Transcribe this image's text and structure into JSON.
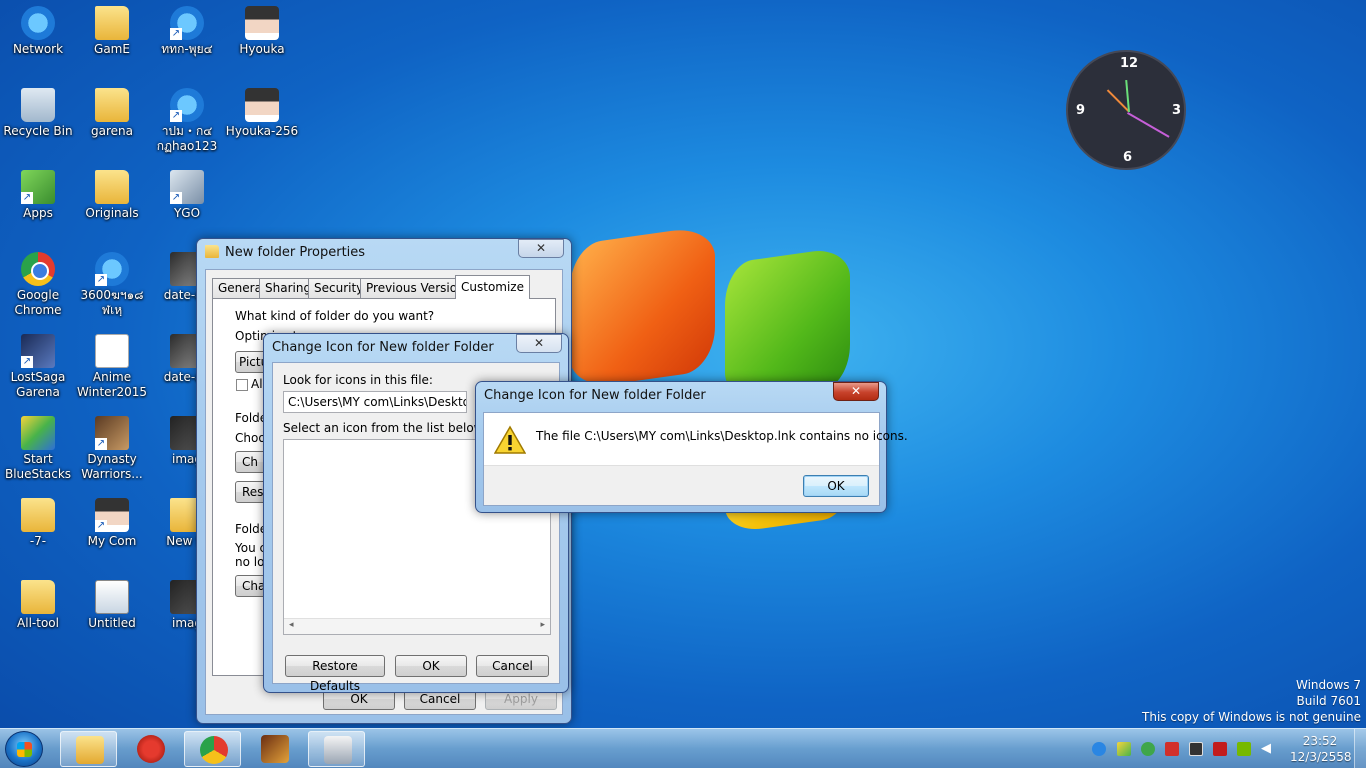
{
  "desktop": {
    "icons": [
      {
        "label": "Network"
      },
      {
        "label": "GamE"
      },
      {
        "label": "ททก-พุย๔"
      },
      {
        "label": "Hyouka"
      },
      {
        "label": "Recycle Bin"
      },
      {
        "label": "garena"
      },
      {
        "label": "าปม・ก๔ กฏhao123"
      },
      {
        "label": "Hyouka-256"
      },
      {
        "label": "Apps"
      },
      {
        "label": "Originals"
      },
      {
        "label": "YGO"
      },
      {
        "label": "Google Chrome"
      },
      {
        "label": "3600ฆฯ๑๘ ฬเหฺ"
      },
      {
        "label": "date-a-l"
      },
      {
        "label": "LostSaga Garena"
      },
      {
        "label": "Anime Winter2015"
      },
      {
        "label": "date-a-l"
      },
      {
        "label": "Start BlueStacks"
      },
      {
        "label": "Dynasty Warriors..."
      },
      {
        "label": "imag"
      },
      {
        "label": "-7-"
      },
      {
        "label": "My Com"
      },
      {
        "label": "New fo"
      },
      {
        "label": "All-tool"
      },
      {
        "label": "Untitled"
      },
      {
        "label": "imag"
      }
    ]
  },
  "clock": {
    "n12": "12",
    "n3": "3",
    "n6": "6",
    "n9": "9"
  },
  "properties_window": {
    "title": "New folder Properties",
    "close": "✕",
    "tabs": [
      "General",
      "Sharing",
      "Security",
      "Previous Versions",
      "Customize"
    ],
    "active_tab": "Customize",
    "group1_title": "What kind of folder do you want?",
    "optimize_label": "Optimize this folder for:",
    "optimize_value": "Pictur",
    "also_apply_label": "Als",
    "group2_title": "Folder",
    "choose_label": "Choos",
    "choose_button": "Ch",
    "restore_button": "Res",
    "group3_title": "Folder",
    "icons_text_1": "You ca",
    "icons_text_2": "no lon",
    "change_icon_button": "Cha",
    "ok": "OK",
    "cancel": "Cancel",
    "apply": "Apply"
  },
  "change_icon_window": {
    "title": "Change Icon for New folder Folder",
    "close": "✕",
    "look_label": "Look for icons in this file:",
    "file_path": "C:\\Users\\MY com\\Links\\Desktop.lnk",
    "select_label": "Select an icon from the list below:",
    "restore_defaults": "Restore Defaults",
    "ok": "OK",
    "cancel": "Cancel"
  },
  "error_dialog": {
    "title": "Change Icon for New folder Folder",
    "close": "✕",
    "message": "The file C:\\Users\\MY com\\Links\\Desktop.lnk contains no icons.",
    "ok": "OK"
  },
  "watermark": {
    "line1": "Windows 7",
    "line2": "Build 7601",
    "line3": "This copy of Windows is not genuine"
  },
  "taskbar": {
    "time": "23:52",
    "date": "12/3/2558"
  }
}
